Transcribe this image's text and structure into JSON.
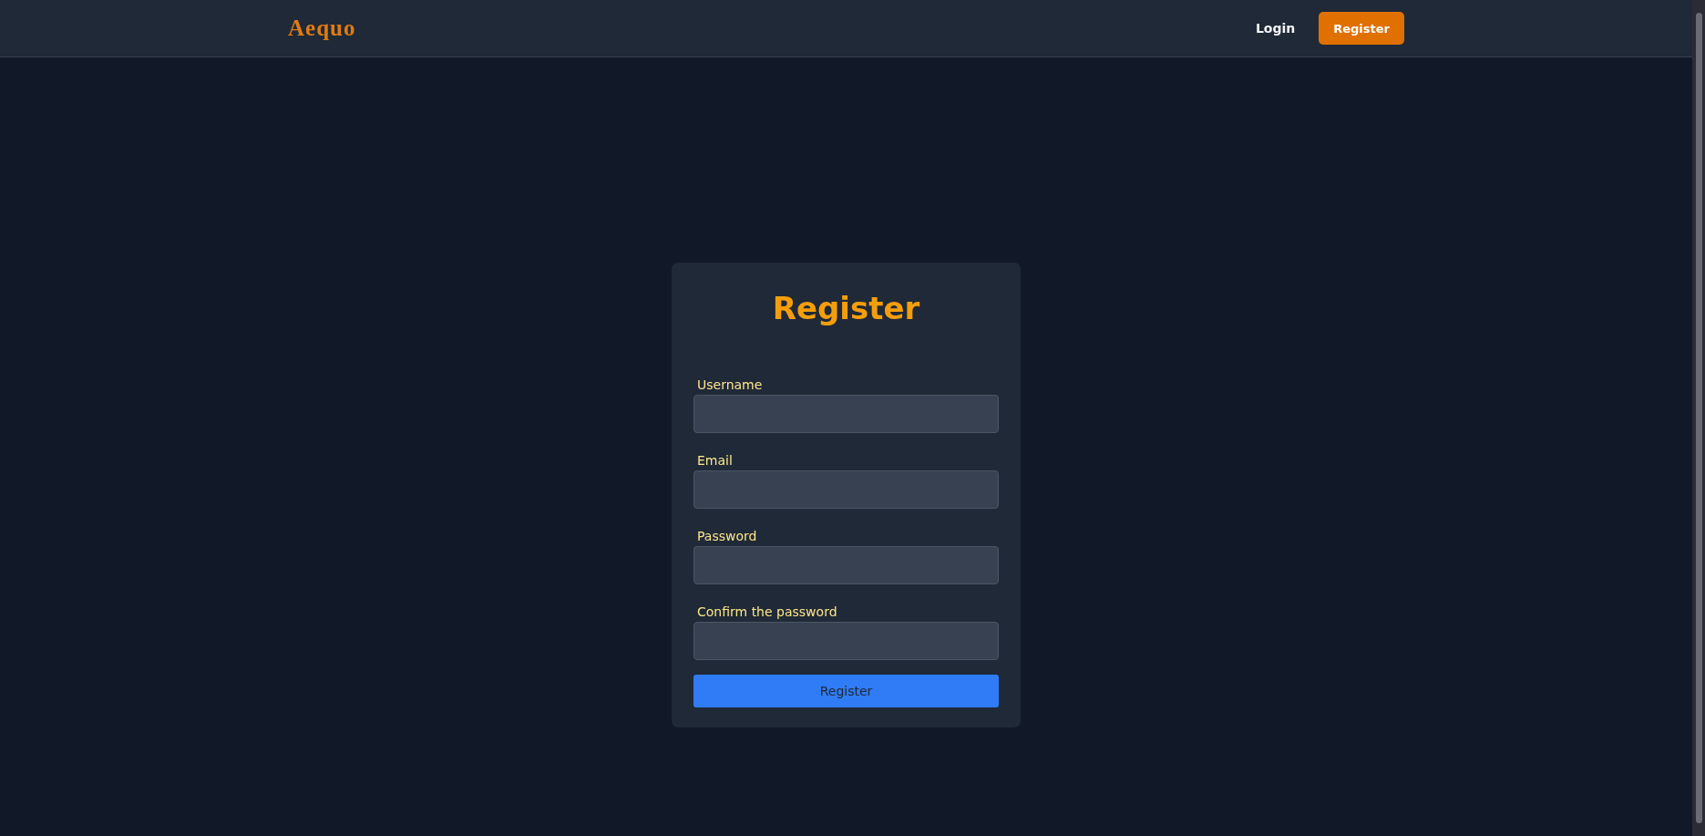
{
  "navbar": {
    "logo": "Aequo",
    "links": [
      {
        "label": "Login",
        "kind": "link"
      },
      {
        "label": "Register",
        "kind": "button"
      }
    ]
  },
  "form": {
    "title": "Register",
    "fields": [
      {
        "label": "Username"
      },
      {
        "label": "Email"
      },
      {
        "label": "Password"
      },
      {
        "label": "Confirm the password"
      }
    ],
    "submit": "Register"
  }
}
